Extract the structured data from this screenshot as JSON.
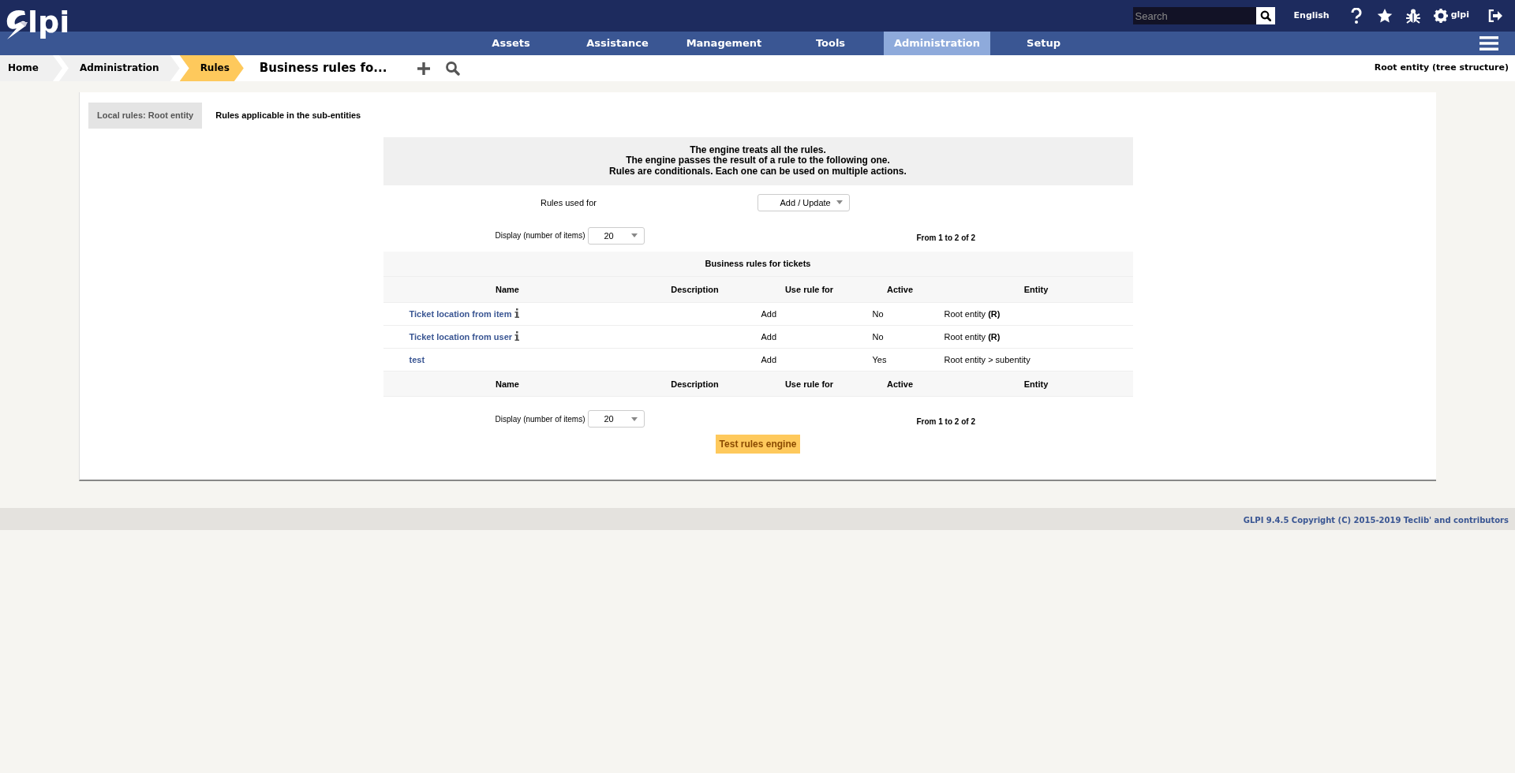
{
  "header": {
    "logo_text": "lpi",
    "search": {
      "placeholder": "Search"
    },
    "language": "English",
    "user": "glpi"
  },
  "menu": [
    {
      "label": "Assets",
      "selected": false
    },
    {
      "label": "Assistance",
      "selected": false
    },
    {
      "label": "Management",
      "selected": false
    },
    {
      "label": "Tools",
      "selected": false
    },
    {
      "label": "Administration",
      "selected": true
    },
    {
      "label": "Setup",
      "selected": false
    }
  ],
  "breadcrumb": [
    {
      "label": "Home",
      "selected": false
    },
    {
      "label": "Administration",
      "selected": false
    },
    {
      "label": "Rules",
      "selected": true
    }
  ],
  "page_title": "Business rules fo...",
  "entity": "Root entity (tree structure)",
  "tabs": [
    {
      "label": "Local rules: Root entity",
      "selected": true
    },
    {
      "label": "Rules applicable in the sub-entities",
      "selected": false
    }
  ],
  "info_lines": [
    "The engine treats all the rules.",
    "The engine passes the result of a rule to the following one.",
    "Rules are conditionals. Each one can be used on multiple actions."
  ],
  "rules_used_for": {
    "label": "Rules used for",
    "value": "Add / Update"
  },
  "pager_top": {
    "label": "Display (number of items)",
    "value": "20",
    "range": "From 1 to 2 of 2"
  },
  "table": {
    "title": "Business rules for tickets",
    "columns": [
      "Name",
      "Description",
      "Use rule for",
      "Active",
      "Entity"
    ],
    "rows": [
      {
        "name": "Ticket location from item",
        "has_info": true,
        "description": "",
        "use_rule_for": "Add",
        "active": "No",
        "entity": "Root entity **(R)**"
      },
      {
        "name": "Ticket location from user",
        "has_info": true,
        "description": "",
        "use_rule_for": "Add",
        "active": "No",
        "entity": "Root entity **(R)**"
      },
      {
        "name": "test",
        "has_info": false,
        "description": "",
        "use_rule_for": "Add",
        "active": "Yes",
        "entity": "Root entity > subentity"
      }
    ],
    "footer_columns": [
      "Name",
      "Description",
      "Use rule for",
      "Active",
      "Entity"
    ]
  },
  "pager_bottom": {
    "label": "Display (number of items)",
    "value": "20",
    "range": "From 1 to 2 of 2"
  },
  "test_button": "Test rules engine",
  "footer": "GLPI 9.4.5 Copyright (C) 2015-2019 Teclib' and contributors"
}
